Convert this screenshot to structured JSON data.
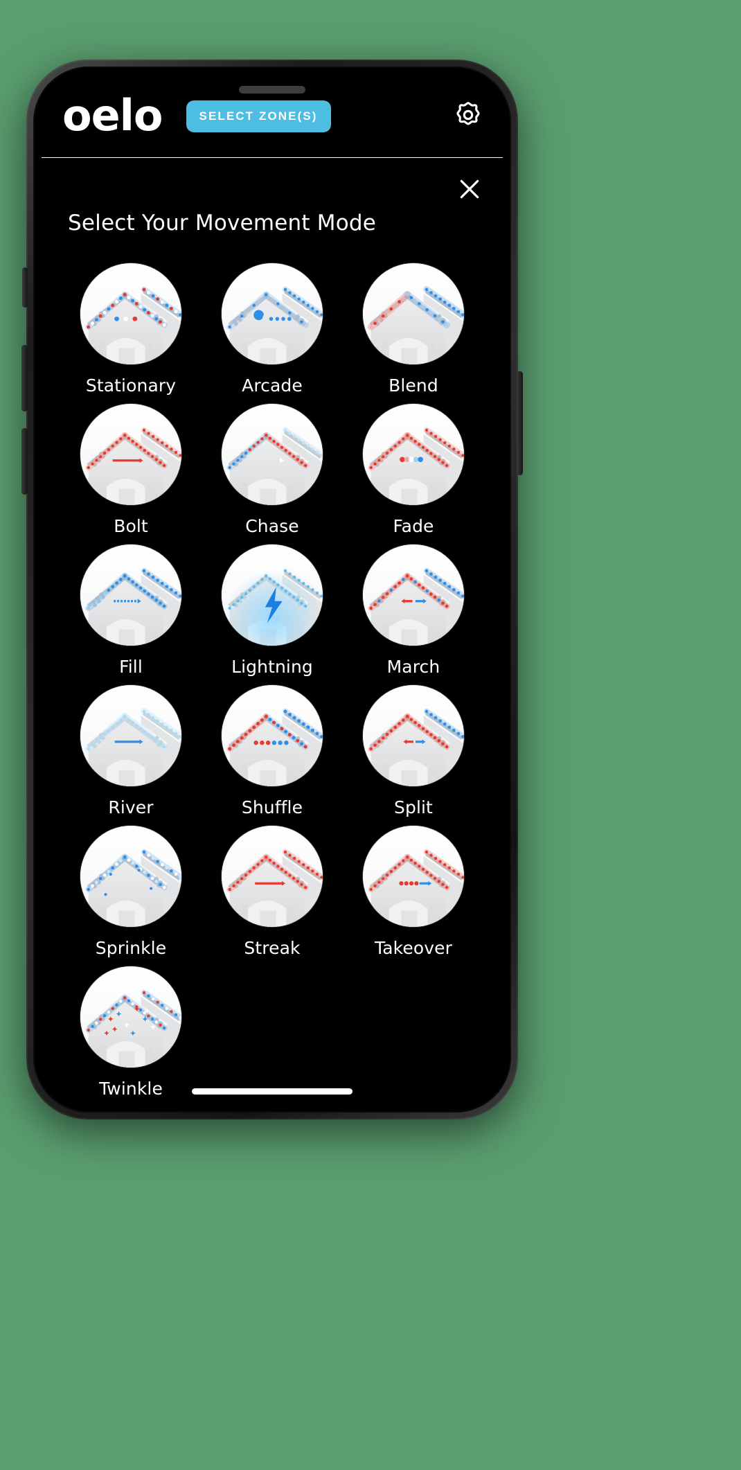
{
  "device": {
    "type": "smartphone-mockup",
    "background_color": "#5a9e6f",
    "frame_color": "#1c1c1c",
    "screen_background": "#000000"
  },
  "header": {
    "brand": "oelo",
    "select_zones_label": "SELECT ZONE(S)",
    "select_zones_color": "#4ebde2",
    "settings_icon": "gear-icon"
  },
  "panel": {
    "title": "Select Your Movement Mode",
    "close_icon": "close-icon"
  },
  "modes": [
    {
      "label": "Stationary",
      "effect": "static-dots",
      "colors": [
        "#e8392f",
        "#2f8fe8",
        "#ffffff"
      ]
    },
    {
      "label": "Arcade",
      "effect": "pacman",
      "colors": [
        "#2f8fe8"
      ]
    },
    {
      "label": "Blend",
      "effect": "soft-blend",
      "colors": [
        "#e8392f",
        "#2f8fe8",
        "#ffffff"
      ]
    },
    {
      "label": "Bolt",
      "effect": "arrow-right",
      "colors": [
        "#e8392f"
      ]
    },
    {
      "label": "Chase",
      "effect": "gradient-arrow-right",
      "colors": [
        "#2f8fe8",
        "#e8392f",
        "#ffffff"
      ]
    },
    {
      "label": "Fade",
      "effect": "fade-dots",
      "colors": [
        "#e8392f",
        "#ffffff",
        "#2f8fe8"
      ]
    },
    {
      "label": "Fill",
      "effect": "fill-arrow-right",
      "colors": [
        "#2f8fe8"
      ]
    },
    {
      "label": "Lightning",
      "effect": "lightning-bolt",
      "colors": [
        "#1a7fe0"
      ]
    },
    {
      "label": "March",
      "effect": "march-arrows",
      "colors": [
        "#e8392f",
        "#2f8fe8"
      ]
    },
    {
      "label": "River",
      "effect": "river-arrow",
      "colors": [
        "#2f8fe8"
      ]
    },
    {
      "label": "Shuffle",
      "effect": "shuffle-dots",
      "colors": [
        "#e8392f",
        "#2f8fe8"
      ]
    },
    {
      "label": "Split",
      "effect": "split-arrows",
      "colors": [
        "#e8392f",
        "#2f8fe8"
      ]
    },
    {
      "label": "Sprinkle",
      "effect": "sprinkle-dots",
      "colors": [
        "#e8392f",
        "#2f8fe8",
        "#ffffff"
      ]
    },
    {
      "label": "Streak",
      "effect": "streak-arrow",
      "colors": [
        "#e8392f"
      ]
    },
    {
      "label": "Takeover",
      "effect": "takeover-arrow",
      "colors": [
        "#e8392f",
        "#2f8fe8"
      ]
    },
    {
      "label": "Twinkle",
      "effect": "twinkle-sparkles",
      "colors": [
        "#e8392f",
        "#2f8fe8",
        "#ffffff"
      ]
    }
  ]
}
